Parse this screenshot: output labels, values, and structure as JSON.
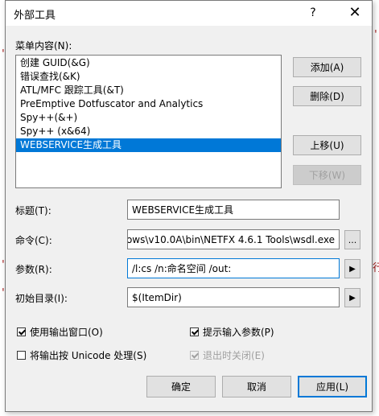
{
  "dialog": {
    "title": "外部工具",
    "help_glyph": "?",
    "close_glyph": "✕"
  },
  "menu_contents": {
    "label": "菜单内容(N):",
    "items": [
      {
        "label": "创建 GUID(&G)"
      },
      {
        "label": "错误查找(&K)"
      },
      {
        "label": "ATL/MFC 跟踪工具(&T)"
      },
      {
        "label": "PreEmptive Dotfuscator and Analytics"
      },
      {
        "label": "Spy++(&+)"
      },
      {
        "label": "Spy++ (x&64)"
      },
      {
        "label": "WEBSERVICE生成工具"
      }
    ],
    "selected_index": 6
  },
  "side_buttons": {
    "add": "添加(A)",
    "delete": "删除(D)",
    "move_up": "上移(U)",
    "move_down": "下移(W)"
  },
  "fields": {
    "title_label": "标题(T):",
    "title_value": "WEBSERVICE生成工具",
    "command_label": "命令(C):",
    "command_value": "ows\\v10.0A\\bin\\NETFX 4.6.1 Tools\\wsdl.exe",
    "args_label": "参数(R):",
    "args_value": "/l:cs /n:命名空间 /out:",
    "initdir_label": "初始目录(I):",
    "initdir_value": "$(ItemDir)",
    "browse_glyph": "...",
    "arrow_glyph": "▶"
  },
  "options": {
    "use_output_window": {
      "label": "使用输出窗口(O)",
      "checked": true
    },
    "prompt_args": {
      "label": "提示输入参数(P)",
      "checked": true
    },
    "treat_unicode": {
      "label": "将输出按 Unicode 处理(S)",
      "checked": false
    },
    "close_on_exit": {
      "label": "退出时关闭(E)",
      "checked": true
    }
  },
  "footer": {
    "ok": "确定",
    "cancel": "取消",
    "apply": "应用(L)"
  },
  "background_fragments": {
    "top_right": "'y",
    "mid_right": "行",
    "left_marks": "'"
  }
}
